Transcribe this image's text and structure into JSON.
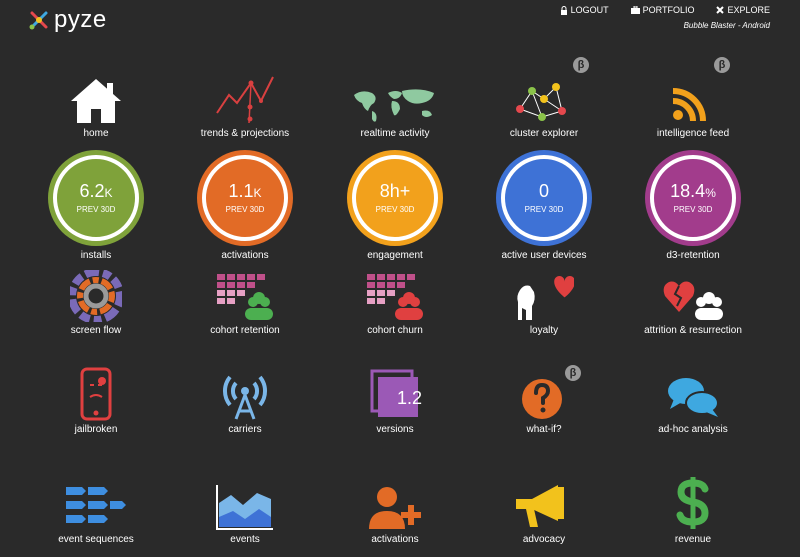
{
  "header": {
    "brand": "pyze",
    "nav": [
      {
        "label": "LOGOUT",
        "icon": "lock-icon"
      },
      {
        "label": "PORTFOLIO",
        "icon": "briefcase-icon"
      },
      {
        "label": "EXPLORE",
        "icon": "close-icon"
      }
    ],
    "app_subtitle": "Bubble Blaster - Android"
  },
  "row1": [
    {
      "label": "home",
      "icon": "home-icon"
    },
    {
      "label": "trends & projections",
      "icon": "trends-icon"
    },
    {
      "label": "realtime activity",
      "icon": "world-map-icon"
    },
    {
      "label": "cluster explorer",
      "icon": "cluster-icon",
      "beta": "β"
    },
    {
      "label": "intelligence feed",
      "icon": "rss-feed-icon",
      "beta": "β"
    }
  ],
  "metrics": [
    {
      "label": "installs",
      "value": "6.2",
      "unit": "K",
      "prev": "PREV 30D",
      "color": "#7fa23a"
    },
    {
      "label": "activations",
      "value": "1.1",
      "unit": "K",
      "prev": "PREV 30D",
      "color": "#e26b26"
    },
    {
      "label": "engagement",
      "value": "8h+",
      "unit": "",
      "prev": "PREV 30D",
      "color": "#f2a11c"
    },
    {
      "label": "active user devices",
      "value": "0",
      "unit": "",
      "prev": "PREV 30D",
      "color": "#3e72d6"
    },
    {
      "label": "d3-retention",
      "value": "18.4",
      "unit": "%",
      "prev": "PREV 30D",
      "color": "#a23c8c"
    }
  ],
  "row3": [
    {
      "label": "screen flow",
      "icon": "sunburst-icon"
    },
    {
      "label": "cohort retention",
      "icon": "cohort-retention-icon"
    },
    {
      "label": "cohort churn",
      "icon": "cohort-churn-icon"
    },
    {
      "label": "loyalty",
      "icon": "dog-heart-icon"
    },
    {
      "label": "attrition & resurrection",
      "icon": "broken-heart-icon"
    }
  ],
  "row4": [
    {
      "label": "jailbroken",
      "icon": "jailbroken-phone-icon"
    },
    {
      "label": "carriers",
      "icon": "antenna-icon"
    },
    {
      "label": "versions",
      "icon": "versions-icon",
      "badge": "1.2"
    },
    {
      "label": "what-if?",
      "icon": "question-icon",
      "beta": "β"
    },
    {
      "label": "ad-hoc analysis",
      "icon": "chat-bubbles-icon"
    }
  ],
  "row5": [
    {
      "label": "event sequences",
      "icon": "sequence-arrows-icon"
    },
    {
      "label": "events",
      "icon": "area-chart-icon"
    },
    {
      "label": "activations",
      "icon": "add-user-icon"
    },
    {
      "label": "advocacy",
      "icon": "megaphone-icon"
    },
    {
      "label": "revenue",
      "icon": "dollar-icon"
    }
  ]
}
